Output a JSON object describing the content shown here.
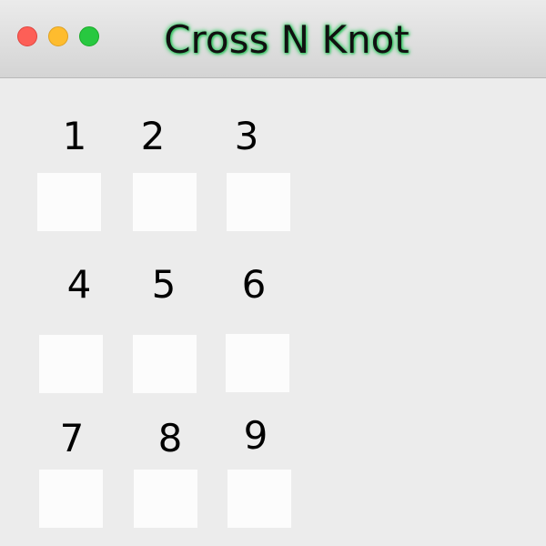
{
  "window": {
    "title": "Cross N Knot",
    "controls": {
      "close_color": "#fd5f57",
      "minimize_color": "#febc2e",
      "zoom_color": "#28c840"
    }
  },
  "board": {
    "labels": [
      "1",
      "2",
      "3",
      "4",
      "5",
      "6",
      "7",
      "8",
      "9"
    ]
  }
}
